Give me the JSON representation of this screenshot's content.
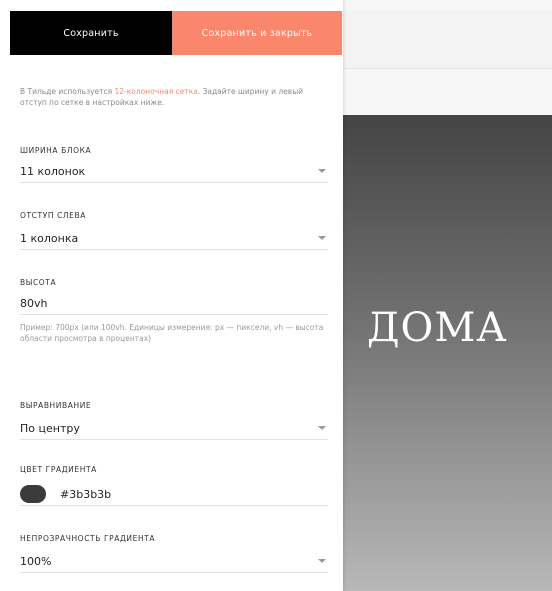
{
  "toolbar": {
    "save_label": "Сохранить",
    "save_close_label": "Сохранить и закрыть",
    "save_close_color": "#fa876b"
  },
  "info": {
    "prefix": "В Тильде используется ",
    "link": "12-колоночная сетка",
    "suffix": ". Задайте ширину и левый отступ по сетке в настройках ниже."
  },
  "fields": {
    "width": {
      "label": "ШИРИНА БЛОКА",
      "value": "11 колонок"
    },
    "offset": {
      "label": "ОТСТУП СЛЕВА",
      "value": "1 колонка"
    },
    "height": {
      "label": "ВЫСОТА",
      "value": "80vh",
      "hint": "Пример: 700px (или 100vh. Единицы измерения: px — пиксели, vh — высота области просмотра в процентах)"
    },
    "align": {
      "label": "ВЫРАВНИВАНИЕ",
      "value": "По центру"
    },
    "gradient_color": {
      "label": "ЦВЕТ ГРАДИЕНТА",
      "value": "#3b3b3b",
      "swatch": "#3b3b3b"
    },
    "gradient_opacity": {
      "label": "НЕПРОЗРАЧНОСТЬ ГРАДИЕНТА",
      "value": "100%"
    }
  },
  "preview": {
    "title": "ДОМА"
  }
}
